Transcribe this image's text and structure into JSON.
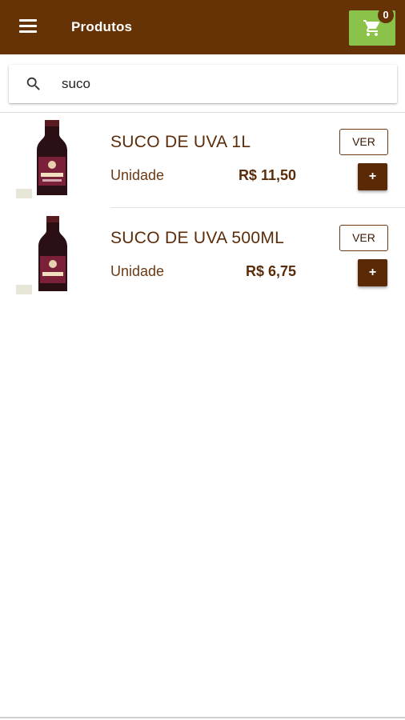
{
  "header": {
    "title": "Produtos",
    "cart_count": "0",
    "bar_color": "#663307",
    "cart_color": "#8bc34a",
    "menu_icon": "menu-icon",
    "cart_icon": "shopping-cart-icon"
  },
  "search": {
    "value": "suco",
    "icon": "search-icon"
  },
  "products": [
    {
      "name": "SUCO DE UVA 1L",
      "unit": "Unidade",
      "price": "R$ 11,50",
      "view_label": "VER",
      "add_label": "+",
      "image": "grape-juice-bottle"
    },
    {
      "name": "SUCO DE UVA 500ML",
      "unit": "Unidade",
      "price": "R$ 6,75",
      "view_label": "VER",
      "add_label": "+",
      "image": "grape-juice-bottle"
    }
  ]
}
